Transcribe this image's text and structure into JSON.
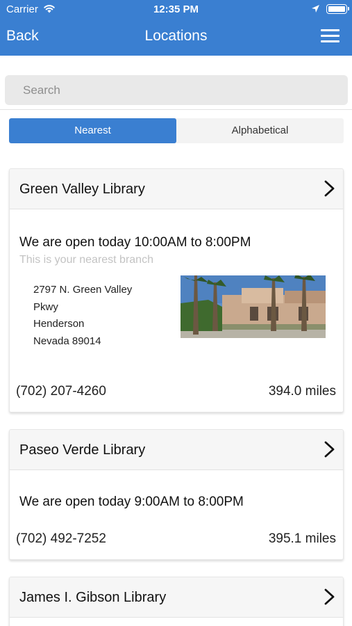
{
  "status_bar": {
    "carrier": "Carrier",
    "time": "12:35 PM"
  },
  "nav": {
    "back_label": "Back",
    "title": "Locations"
  },
  "search": {
    "placeholder": "Search"
  },
  "segments": {
    "nearest": "Nearest",
    "alphabetical": "Alphabetical",
    "selected": "Nearest"
  },
  "colors": {
    "brand_blue": "#3a7fd1"
  },
  "locations": [
    {
      "name": "Green Valley Library",
      "hours": "We are open today 10:00AM to 8:00PM",
      "nearest_note": "This is your nearest branch",
      "address_lines": [
        "2797 N. Green Valley",
        "Pkwy",
        "Henderson",
        "Nevada 89014"
      ],
      "phone": "(702) 207-4260",
      "distance": "394.0 miles"
    },
    {
      "name": "Paseo Verde Library",
      "hours": "We are open today 9:00AM to 8:00PM",
      "phone": "(702) 492-7252",
      "distance": "395.1 miles"
    },
    {
      "name": "James I. Gibson Library"
    }
  ]
}
